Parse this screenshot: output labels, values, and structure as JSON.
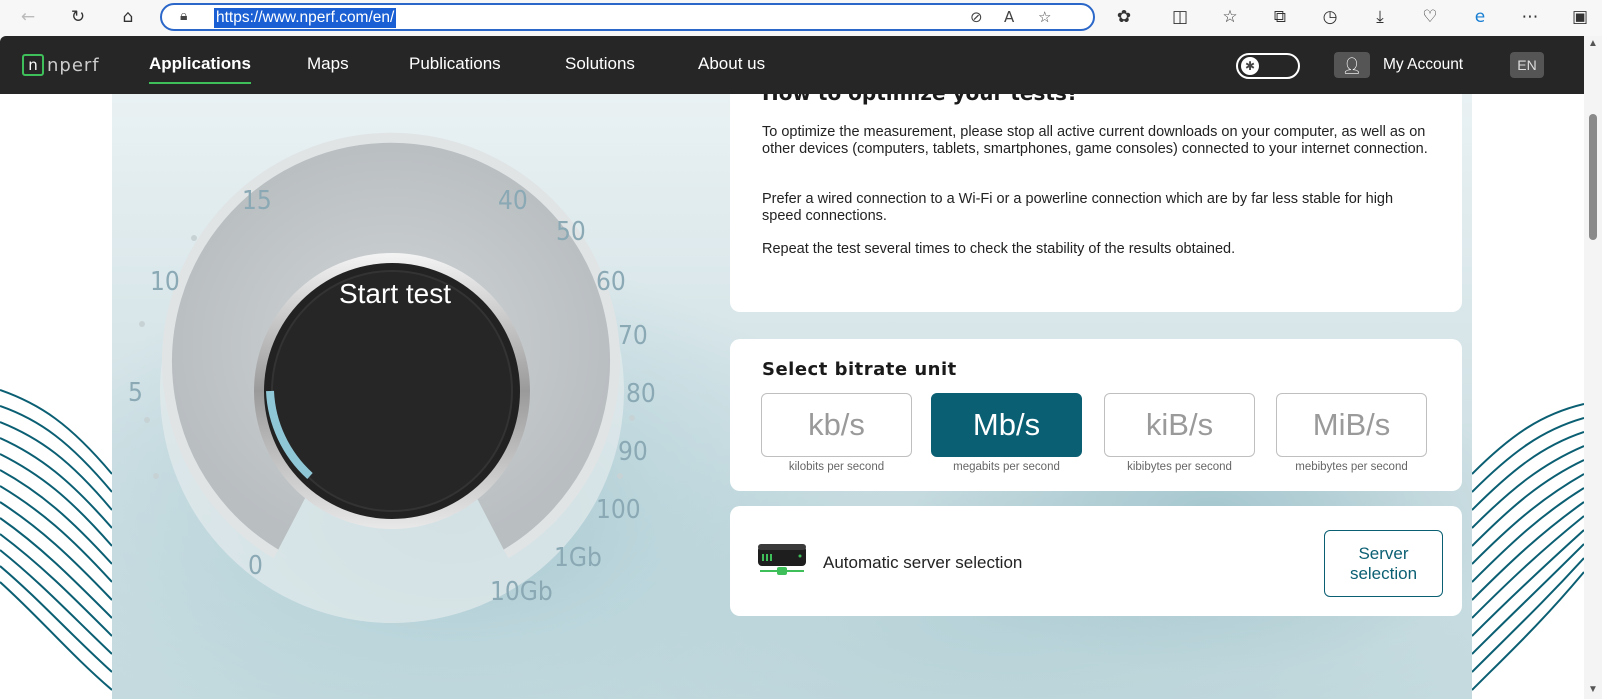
{
  "browser": {
    "url": "https://www.nperf.com/en/",
    "back_icon": "arrow-left-icon",
    "reload_icon": "reload-icon",
    "home_icon": "home-icon"
  },
  "nav": {
    "logo_text": "nperf",
    "items": [
      {
        "label": "Applications",
        "active": true
      },
      {
        "label": "Maps"
      },
      {
        "label": "Publications"
      },
      {
        "label": "Solutions"
      },
      {
        "label": "About us"
      }
    ],
    "account_label": "My Account",
    "language": "EN"
  },
  "gauge": {
    "start_label": "Start test",
    "scale": [
      "0",
      "5",
      "10",
      "15",
      "40",
      "50",
      "60",
      "70",
      "80",
      "90",
      "100",
      "1Gb",
      "10Gb"
    ]
  },
  "tips": {
    "title": "How to optimize your tests?",
    "paragraphs": [
      "To optimize the measurement, please stop all active current downloads on your computer, as well as on other devices (computers, tablets, smartphones, game consoles) connected to your internet connection.",
      "Prefer a wired connection to a Wi-Fi or a powerline connection which are by far less stable for high speed connections.",
      "Repeat the test several times to check the stability of the results obtained."
    ]
  },
  "bitrate": {
    "title": "Select bitrate unit",
    "units": [
      {
        "label": "kb/s",
        "desc": "kilobits per second"
      },
      {
        "label": "Mb/s",
        "desc": "megabits per second",
        "selected": true
      },
      {
        "label": "kiB/s",
        "desc": "kibibytes per second"
      },
      {
        "label": "MiB/s",
        "desc": "mebibytes per second"
      }
    ]
  },
  "server": {
    "label": "Automatic server selection",
    "button": "Server selection"
  },
  "colors": {
    "accent": "#0b5f73",
    "brand_green": "#3fbf5a",
    "nav_bg": "#262626"
  }
}
